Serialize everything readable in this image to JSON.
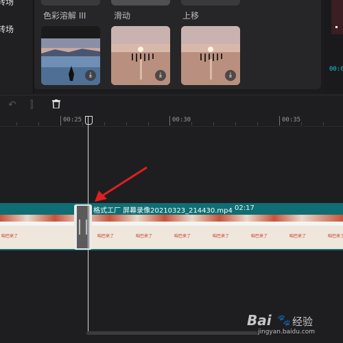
{
  "sidebar": {
    "items": [
      {
        "label": "转场"
      },
      {
        "label": "转场"
      }
    ]
  },
  "library": {
    "top_labels": [
      "色彩溶解 III",
      "滑动",
      "上移"
    ],
    "items": [
      {
        "name": "thumbnail-1",
        "download_icon": "download-icon"
      },
      {
        "name": "thumbnail-2",
        "download_icon": "download-icon"
      },
      {
        "name": "thumbnail-3",
        "download_icon": "download-icon"
      }
    ]
  },
  "right_panel": {
    "time": "00:0"
  },
  "toolbar": {
    "icons": [
      "undo-icon",
      "redo-icon",
      "split-icon",
      "delete-icon"
    ]
  },
  "ruler": {
    "labels": [
      "00:25",
      "00:30",
      "00:35"
    ]
  },
  "clip": {
    "name": "格式工厂 屏幕录像20210323_214430.mp4",
    "duration": "02:17",
    "frame_text": "咱巴来了"
  },
  "watermark": {
    "text": "Bai",
    "suffix": "经验",
    "url": "jingyan.baidu.com"
  },
  "colors": {
    "clip_header": "#0f6e73",
    "arrow": "#e02020",
    "background": "#1e1e20"
  }
}
